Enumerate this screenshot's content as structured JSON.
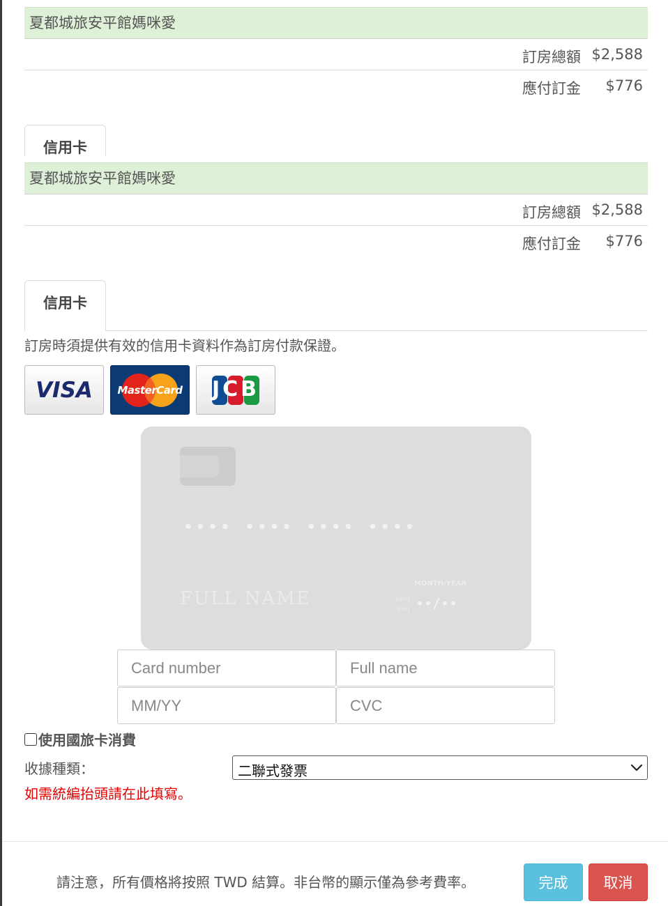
{
  "summary_blocks": [
    {
      "hotel_name": "夏都城旅安平館媽咪愛",
      "total_label": "訂房總額",
      "total_value": "$2,588",
      "deposit_label": "應付訂金",
      "deposit_value": "$776"
    },
    {
      "hotel_name": "夏都城旅安平館媽咪愛",
      "total_label": "訂房總額",
      "total_value": "$2,588",
      "deposit_label": "應付訂金",
      "deposit_value": "$776"
    }
  ],
  "tabs": [
    "信用卡",
    "信用卡"
  ],
  "payment": {
    "notice": "訂房時須提供有效的信用卡資料作為訂房付款保證。",
    "brands": {
      "visa": "VISA",
      "mastercard": "MasterCard",
      "jcb": "JCB"
    },
    "card_preview": {
      "number": "•••• •••• •••• ••••",
      "name": "FULL NAME",
      "month_year_label": "MONTH/YEAR",
      "valid_thru_line1": "valid",
      "valid_thru_line2": "thru",
      "expiry": "••/••"
    },
    "fields": {
      "card_number_placeholder": "Card number",
      "full_name_placeholder": "Full name",
      "expiry_placeholder": "MM/YY",
      "cvc_placeholder": "CVC"
    },
    "travel_card_label": "使用國旅卡消費",
    "travel_card_checked": false,
    "receipt_label": "收據種類：",
    "receipt_selected": "二聯式發票",
    "receipt_note": "如需統編抬頭請在此填寫。"
  },
  "footer": {
    "note": "請注意，所有價格將按照 TWD 結算。非台幣的顯示僅為參考費率。",
    "done_label": "完成",
    "cancel_label": "取消"
  },
  "colors": {
    "hotel_row_bg": "#dff0d8",
    "done_button": "#5bc0de",
    "cancel_button": "#d9534f",
    "note_red": "#e60000"
  },
  "icons": [
    "chevron-down-icon",
    "card-chip-icon"
  ]
}
